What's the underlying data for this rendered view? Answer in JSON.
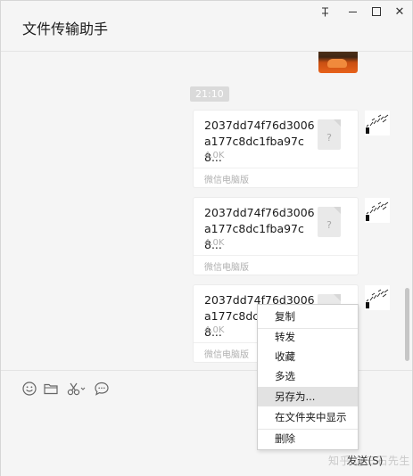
{
  "window": {
    "title": "文件传输助手",
    "controls": [
      "pin-icon",
      "minimize-icon",
      "maximize-icon",
      "close-icon"
    ]
  },
  "chat": {
    "timestamp": "21:10",
    "messages": [
      {
        "file_name": "2037dd74f76d3006 a177c8dc1fba97c8...",
        "file_size": "4.0K",
        "source": "微信电脑版",
        "file_icon": "?"
      },
      {
        "file_name": "2037dd74f76d3006 a177c8dc1fba97c8...",
        "file_size": "4.0K",
        "source": "微信电脑版",
        "file_icon": "?"
      },
      {
        "file_name": "2037dd74f76d3006 a177c8dc1fba97c8...",
        "file_size": "4.0K",
        "source": "微信电脑版",
        "file_icon": "?"
      }
    ]
  },
  "toolbar": {
    "icons": [
      "emoji-icon",
      "folder-icon",
      "scissors-icon",
      "chat-bubble-icon"
    ]
  },
  "context_menu": {
    "items": [
      "复制",
      "转发",
      "收藏",
      "多选",
      "另存为...",
      "在文件夹中显示",
      "删除"
    ],
    "highlighted": "另存为..."
  },
  "input": {
    "send_label": "发送(S)",
    "watermark": "知乎 @三石先生"
  },
  "colors": {
    "background": "#f5f5f5",
    "card": "#ffffff",
    "menu_hover": "#e2e2e2",
    "timestamp_bg": "#dadada"
  }
}
